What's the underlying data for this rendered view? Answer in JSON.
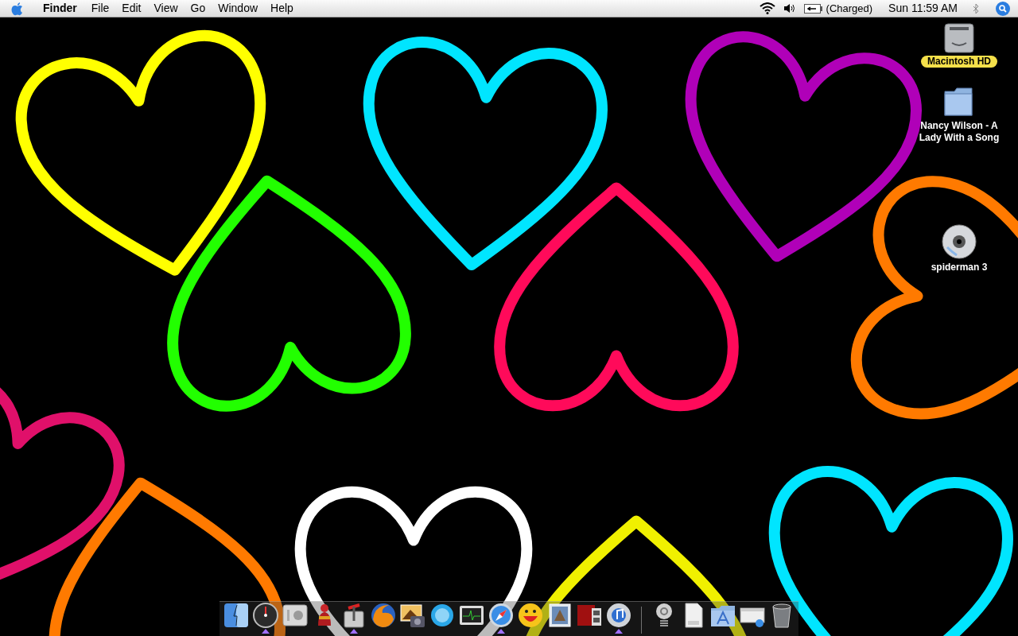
{
  "menu_bar": {
    "app_name": "Finder",
    "menus": [
      "File",
      "Edit",
      "View",
      "Go",
      "Window",
      "Help"
    ],
    "battery_status": "(Charged)",
    "clock": "Sun 11:59 AM"
  },
  "desktop_icons": [
    {
      "kind": "drive",
      "label": "Macintosh HD",
      "selected": true
    },
    {
      "kind": "folder",
      "label": "Nancy Wilson - A Lady With a Song",
      "selected": false
    },
    {
      "kind": "dvd",
      "label": "spiderman 3",
      "selected": false
    }
  ],
  "dock": [
    {
      "kind": "finder",
      "running": false
    },
    {
      "kind": "dashboard",
      "running": true
    },
    {
      "kind": "prefs",
      "running": false
    },
    {
      "kind": "figure",
      "running": false
    },
    {
      "kind": "lever",
      "running": true
    },
    {
      "kind": "globe",
      "running": false
    },
    {
      "kind": "photo",
      "running": false
    },
    {
      "kind": "chat",
      "running": false
    },
    {
      "kind": "monitor",
      "running": false
    },
    {
      "kind": "compass",
      "running": true
    },
    {
      "kind": "smiley",
      "running": false
    },
    {
      "kind": "stamp",
      "running": false
    },
    {
      "kind": "film",
      "running": false
    },
    {
      "kind": "music",
      "running": true
    },
    {
      "kind": "separator"
    },
    {
      "kind": "spring",
      "running": false
    },
    {
      "kind": "document",
      "running": false
    },
    {
      "kind": "appfolder",
      "running": false
    },
    {
      "kind": "window",
      "running": false
    },
    {
      "kind": "trash",
      "running": false
    }
  ]
}
